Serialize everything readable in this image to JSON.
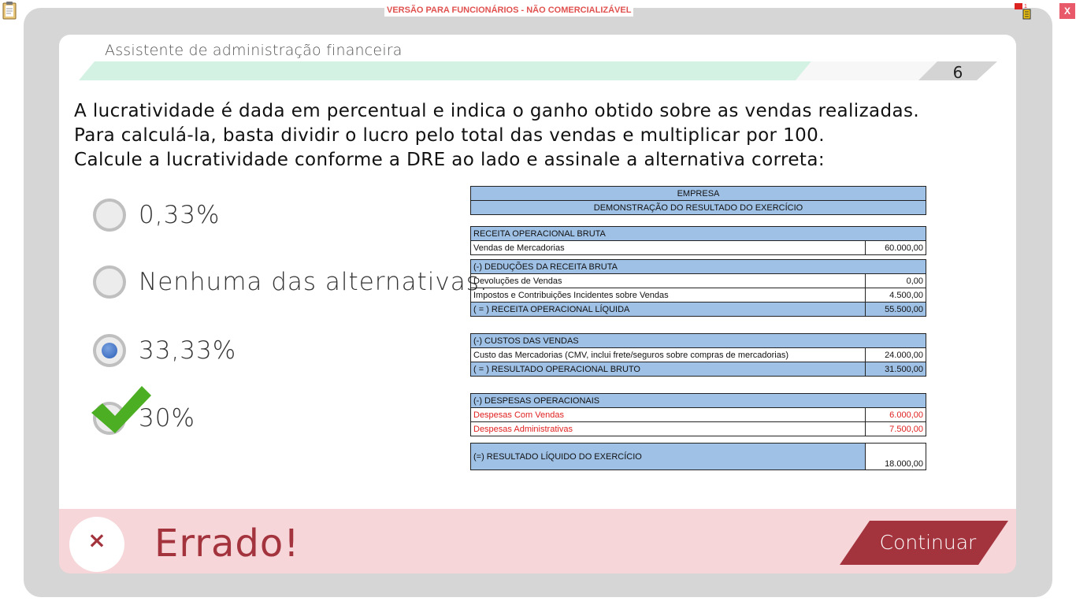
{
  "banner": {
    "text": "VERSÃO PARA FUNCIONÁRIOS - NÃO COMERCIALIZÁVEL"
  },
  "window": {
    "close_label": "X"
  },
  "header": {
    "course_title": "Assistente de administração financeira",
    "page_number": "6"
  },
  "question": {
    "lines": [
      "A lucratividade é dada em percentual e indica o ganho obtido sobre as vendas realizadas.",
      "Para calculá-la, basta dividir o lucro pelo total das vendas e multiplicar por 100.",
      "Calcule a lucratividade conforme a DRE ao lado e assinale a alternativa correta:"
    ]
  },
  "options": [
    {
      "label": "0,33%",
      "selected": false,
      "correct": false
    },
    {
      "label": "Nenhuma das alternativas.",
      "selected": false,
      "correct": false
    },
    {
      "label": "33,33%",
      "selected": true,
      "correct": false
    },
    {
      "label": "30%",
      "selected": false,
      "correct": true
    }
  ],
  "dre": {
    "company": "EMPRESA",
    "title": "DEMONSTRAÇÃO DO RESULTADO DO EXERCÍCIO",
    "receita_bruta_header": "RECEITA OPERACIONAL BRUTA",
    "vendas_label": "Vendas de Mercadorias",
    "vendas_value": "60.000,00",
    "deducoes_header": "(-) DEDUÇÕES DA RECEITA BRUTA",
    "devolucoes_label": "Devoluções de Vendas",
    "devolucoes_value": "0,00",
    "impostos_label": "Impostos e Contribuições Incidentes sobre Vendas",
    "impostos_value": "4.500,00",
    "receita_liquida_label": "( = ) RECEITA OPERACIONAL LÍQUIDA",
    "receita_liquida_value": "55.500,00",
    "custos_header": "(-) CUSTOS DAS VENDAS",
    "cmv_label": "Custo das Mercadorias  (CMV, inclui frete/seguros sobre compras de mercadorias)",
    "cmv_value": "24.000,00",
    "resultado_bruto_label": "( = ) RESULTADO OPERACIONAL BRUTO",
    "resultado_bruto_value": "31.500,00",
    "despesas_header": "(-) DESPESAS OPERACIONAIS",
    "desp_vendas_label": "Despesas Com Vendas",
    "desp_vendas_value": "6.000,00",
    "desp_adm_label": "Despesas Administrativas",
    "desp_adm_value": "7.500,00",
    "resultado_liquido_label": "(=) RESULTADO LÍQUIDO DO EXERCÍCIO",
    "resultado_liquido_value": "18.000,00"
  },
  "feedback": {
    "icon": "×",
    "text": "Errado!",
    "continue_label": "Continuar"
  },
  "colors": {
    "error": "#a3333d",
    "error_bg": "#f6d6d8",
    "table_header": "#9fc1e6",
    "check": "#4cae22"
  }
}
